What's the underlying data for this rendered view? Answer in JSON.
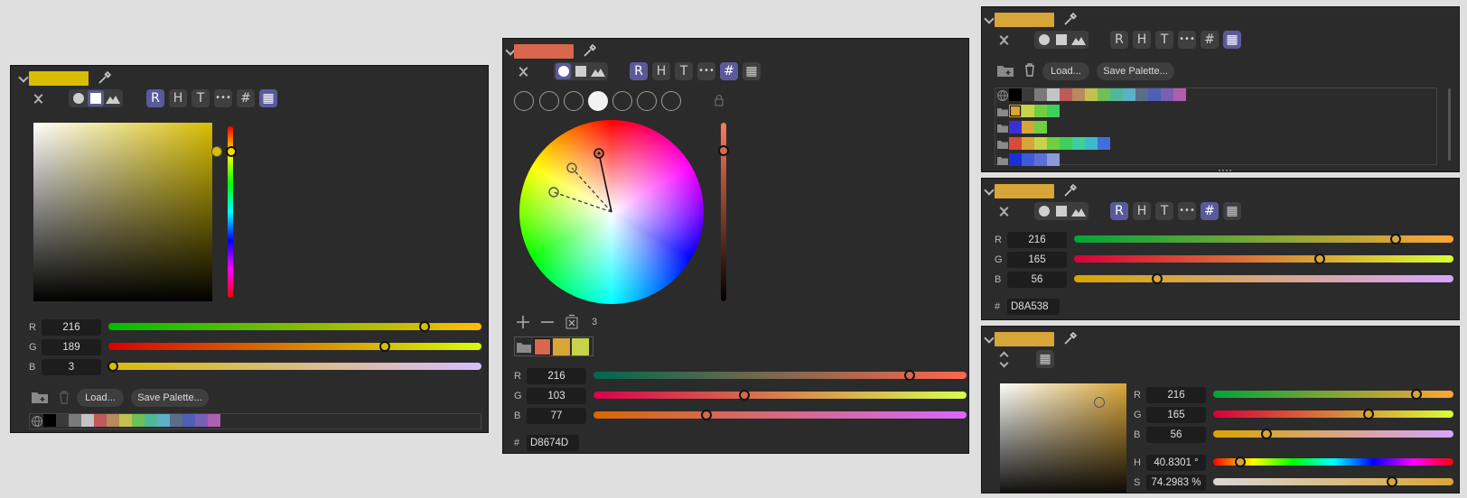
{
  "panel1": {
    "swatch_color": "#D8BD03",
    "modes": [
      "circle",
      "square",
      "image"
    ],
    "mode_selected": "square",
    "model_buttons": [
      "R",
      "H",
      "T",
      "•••",
      "#",
      "▦"
    ],
    "sliders": [
      {
        "label": "R",
        "value": "216"
      },
      {
        "label": "G",
        "value": "189"
      },
      {
        "label": "B",
        "value": "3"
      }
    ],
    "load_label": "Load...",
    "save_label": "Save Palette...",
    "palette": [
      "#000000",
      "#3a3a3a",
      "#7a7a7a",
      "#c4c4c4",
      "#c05a5a",
      "#b88a5e",
      "#c4c050",
      "#6fbf54",
      "#4fb89a",
      "#5cb0c8",
      "#5a6e8a",
      "#4f5fb5",
      "#7a5fb5",
      "#b05fb0"
    ]
  },
  "panel2": {
    "swatch_color": "#D8674D",
    "model_buttons": [
      "R",
      "H",
      "T",
      "•••",
      "#",
      "▦"
    ],
    "harmony_count": "3",
    "swatches": [
      "#D8674D",
      "#D8A538",
      "#C7D34A"
    ],
    "sliders": [
      {
        "label": "R",
        "value": "216"
      },
      {
        "label": "G",
        "value": "103"
      },
      {
        "label": "B",
        "value": "77"
      }
    ],
    "hex_label": "#",
    "hex": "D8674D"
  },
  "panel3": {
    "swatch_color": "#D8A538",
    "model_buttons": [
      "R",
      "H",
      "T",
      "•••",
      "#",
      "▦"
    ],
    "load_label": "Load...",
    "save_label": "Save Palette...",
    "palette_rows": [
      [
        "#000000",
        "#3a3a3a",
        "#7a7a7a",
        "#c4c4c4",
        "#c05a5a",
        "#b88a5e",
        "#c4c050",
        "#6fbf54",
        "#4fb89a",
        "#5cb0c8",
        "#5a6e8a",
        "#4f5fb5",
        "#7a5fb5",
        "#b05fb0"
      ],
      [
        "#D8A538",
        "#C7D34A",
        "#6fcf40",
        "#3fcf5a"
      ],
      [
        "#3a2fd8",
        "#D8A538",
        "#6fcf40"
      ],
      [
        "#d84a3a",
        "#D8A538",
        "#C7D34A",
        "#6fcf40",
        "#3fcf5a",
        "#3fcf9a",
        "#3fb8cf",
        "#3f6fd8"
      ],
      [
        "#1a2fd8",
        "#3f5ad8",
        "#5a6fd8",
        "#8a9ad8"
      ]
    ]
  },
  "panel4": {
    "swatch_color": "#D8A538",
    "model_buttons": [
      "R",
      "H",
      "T",
      "•••",
      "#",
      "▦"
    ],
    "sliders": [
      {
        "label": "R",
        "value": "216"
      },
      {
        "label": "G",
        "value": "165"
      },
      {
        "label": "B",
        "value": "56"
      }
    ],
    "hex_label": "#",
    "hex": "D8A538"
  },
  "panel5": {
    "swatch_color": "#D8A538",
    "sliders": [
      {
        "label": "R",
        "value": "216"
      },
      {
        "label": "G",
        "value": "165"
      },
      {
        "label": "B",
        "value": "56"
      },
      {
        "label": "H",
        "value": "40.8301 °"
      },
      {
        "label": "S",
        "value": "74.2983 %"
      }
    ]
  }
}
